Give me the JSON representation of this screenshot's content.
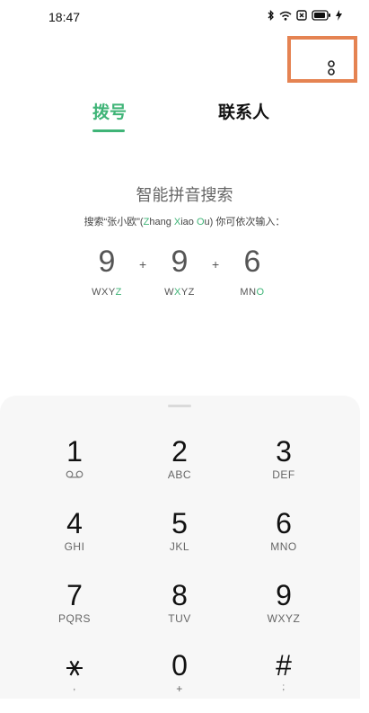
{
  "status": {
    "time": "18:47"
  },
  "tabs": {
    "dial": "拨号",
    "contacts": "联系人"
  },
  "pinyin": {
    "title": "智能拼音搜索",
    "desc_prefix": "搜索“张小欧”(",
    "z": "Z",
    "hang": "hang ",
    "x": "X",
    "iao": "iao ",
    "o": "O",
    "u": "u",
    "desc_suffix": ") 你可依次输入：",
    "example": [
      {
        "digit": "9",
        "pre": "WXY",
        "hl": "Z",
        "post": ""
      },
      {
        "digit": "9",
        "pre": "W",
        "hl": "X",
        "post": "YZ"
      },
      {
        "digit": "6",
        "pre": "MN",
        "hl": "O",
        "post": ""
      }
    ],
    "plus": "+"
  },
  "keys": [
    {
      "digit": "1",
      "letters": "",
      "icon": "voicemail-icon"
    },
    {
      "digit": "2",
      "letters": "ABC"
    },
    {
      "digit": "3",
      "letters": "DEF"
    },
    {
      "digit": "4",
      "letters": "GHI"
    },
    {
      "digit": "5",
      "letters": "JKL"
    },
    {
      "digit": "6",
      "letters": "MNO"
    },
    {
      "digit": "7",
      "letters": "PQRS"
    },
    {
      "digit": "8",
      "letters": "TUV"
    },
    {
      "digit": "9",
      "letters": "WXYZ"
    },
    {
      "digit": "⚹",
      "letters": ","
    },
    {
      "digit": "0",
      "letters": "+"
    },
    {
      "digit": "#",
      "letters": ";"
    }
  ],
  "colors": {
    "accent": "#3fb477",
    "highlight_box": "#e58352"
  }
}
